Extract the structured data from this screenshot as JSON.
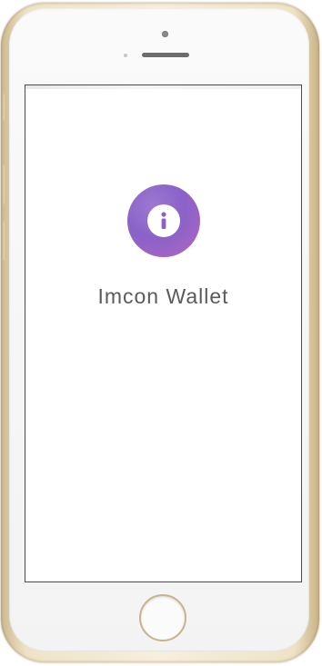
{
  "app": {
    "name": "Imcon Wallet",
    "logo_icon": "info-icon"
  },
  "colors": {
    "logo_gradient_start": "#8a62c8",
    "logo_gradient_end": "#b167c1",
    "title_text": "#5b5b5b",
    "device_frame": "#efe3c6"
  }
}
